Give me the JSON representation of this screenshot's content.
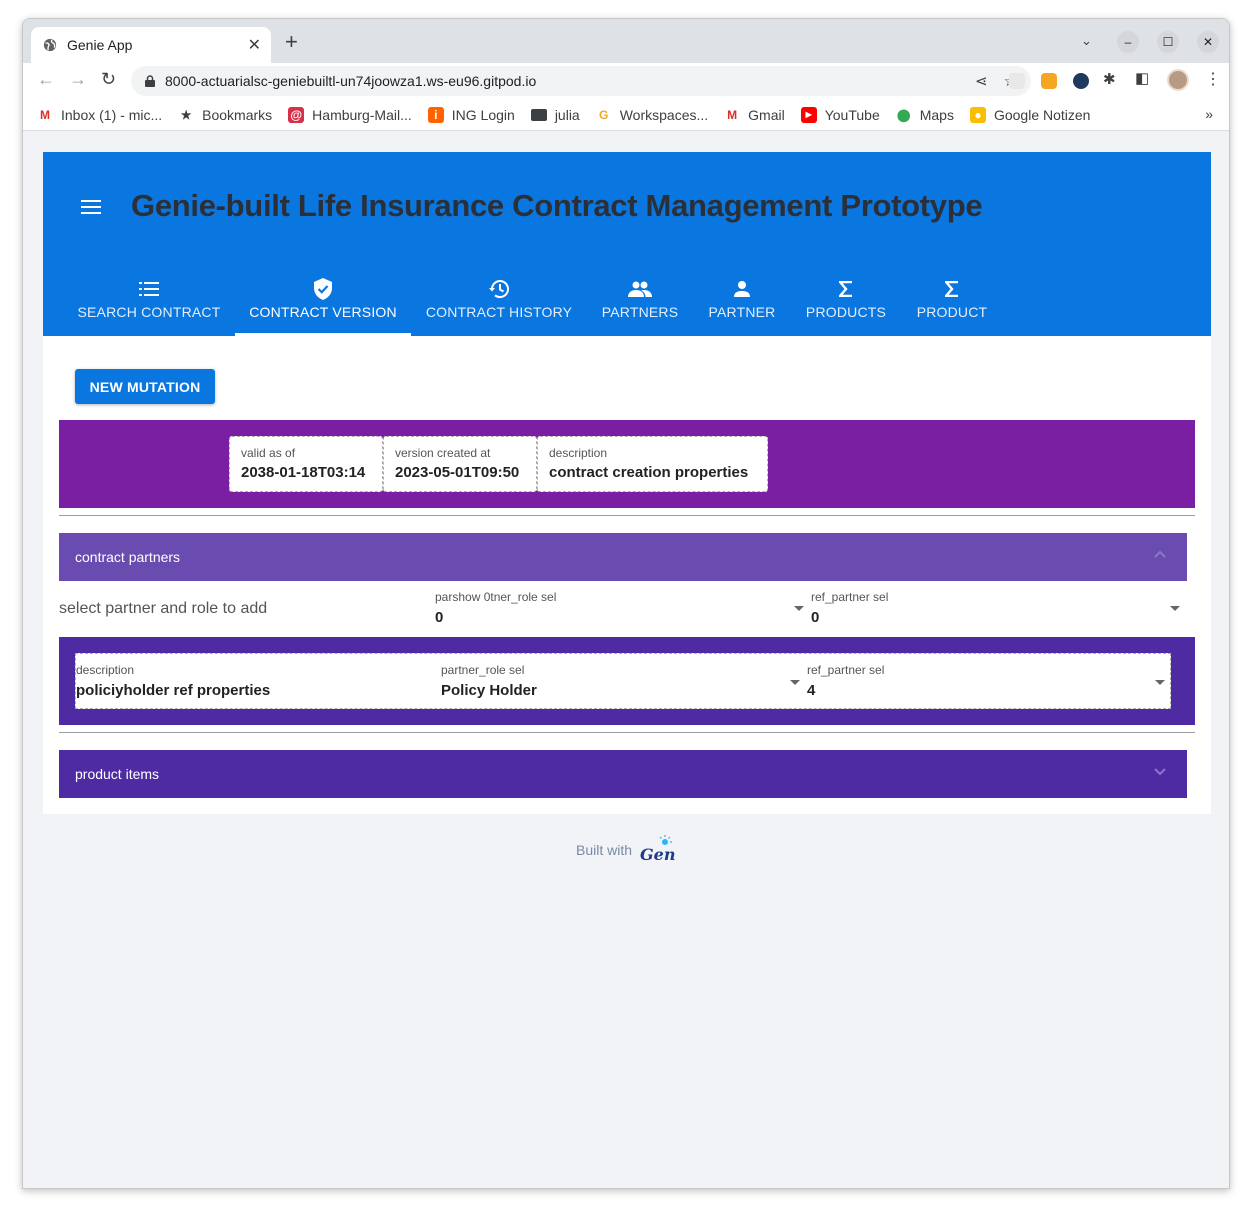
{
  "browser": {
    "tab_title": "Genie App",
    "url": "8000-actuarialsc-geniebuiltl-un74joowza1.ws-eu96.gitpod.io",
    "bookmarks": [
      {
        "label": "Inbox (1) - mic...",
        "icon": "gmail-icon"
      },
      {
        "label": "Bookmarks",
        "icon": "star-icon"
      },
      {
        "label": "Hamburg-Mail...",
        "icon": "mail-icon"
      },
      {
        "label": "ING Login",
        "icon": "ing-icon"
      },
      {
        "label": "julia",
        "icon": "folder-icon"
      },
      {
        "label": "Workspaces...",
        "icon": "gitpod-icon"
      },
      {
        "label": "Gmail",
        "icon": "gmail-icon"
      },
      {
        "label": "YouTube",
        "icon": "youtube-icon"
      },
      {
        "label": "Maps",
        "icon": "maps-icon"
      },
      {
        "label": "Google Notizen",
        "icon": "keep-icon"
      }
    ],
    "bookmarks_more": "»"
  },
  "app": {
    "title": "Genie-built Life Insurance Contract Management Prototype",
    "tabs": [
      {
        "label": "SEARCH CONTRACT",
        "icon": "list-icon",
        "active": false
      },
      {
        "label": "CONTRACT VERSION",
        "icon": "verified-shield-icon",
        "active": true
      },
      {
        "label": "CONTRACT HISTORY",
        "icon": "history-icon",
        "active": false
      },
      {
        "label": "PARTNERS",
        "icon": "people-icon",
        "active": false
      },
      {
        "label": "PARTNER",
        "icon": "person-icon",
        "active": false
      },
      {
        "label": "PRODUCTS",
        "icon": "sigma-icon",
        "active": false
      },
      {
        "label": "PRODUCT",
        "icon": "sigma-icon",
        "active": false
      }
    ],
    "new_mutation_label": "NEW MUTATION",
    "version": {
      "valid_as_of": {
        "label": "valid as of",
        "value": "2038-01-18T03:14"
      },
      "version_created_at": {
        "label": "version created at",
        "value": "2023-05-01T09:50"
      },
      "description": {
        "label": "description",
        "value": "contract creation properties"
      }
    },
    "contract_partners": {
      "header": "contract partners",
      "select_label": "select partner and role to add",
      "role_select": {
        "label": "parshow 0tner_role sel",
        "value": "0"
      },
      "partner_select": {
        "label": "ref_partner sel",
        "value": "0"
      },
      "entries": [
        {
          "description_label": "description",
          "description": "policiyholder ref properties",
          "role_label": "partner_role sel",
          "role": "Policy Holder",
          "partner_label": "ref_partner sel",
          "partner": "4"
        }
      ]
    },
    "product_items": {
      "header": "product items"
    },
    "footer": {
      "built_with": "Built with",
      "logo_text": "Genie"
    }
  },
  "colors": {
    "primary": "#0a77e0",
    "version_band": "#7b1fa2",
    "partners_header": "#6a4bb0",
    "partner_band": "#4f2ba3",
    "product_header": "#4f2ba3"
  }
}
